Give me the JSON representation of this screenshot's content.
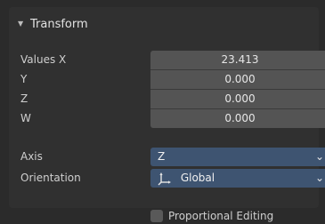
{
  "panel": {
    "title": "Transform"
  },
  "values": {
    "label_x": "Values X",
    "label_y": "Y",
    "label_z": "Z",
    "label_w": "W",
    "x": "23.413",
    "y": "0.000",
    "z": "0.000",
    "w": "0.000"
  },
  "axis": {
    "label": "Axis",
    "value": "Z"
  },
  "orientation": {
    "label": "Orientation",
    "value": "Global"
  },
  "proportional": {
    "label": "Proportional Editing",
    "checked": false
  },
  "colors": {
    "accent_dropdown": "#3e5471",
    "field_bg": "#545454",
    "panel_bg": "#303030"
  },
  "icons": {
    "collapse": "triangle-down-icon",
    "dropdown": "chevron-down-icon",
    "orientation": "transform-axes-icon"
  }
}
